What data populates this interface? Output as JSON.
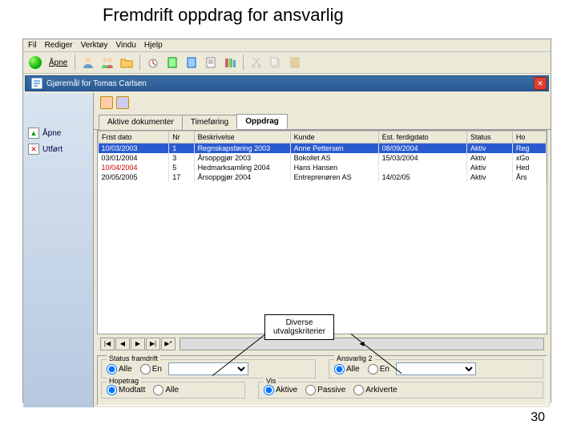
{
  "slide": {
    "title": "Fremdrift oppdrag for ansvarlig",
    "page": "30"
  },
  "menu": [
    "Fil",
    "Rediger",
    "Verktøy",
    "Vindu",
    "Hjelp"
  ],
  "toolbar": {
    "open_label": "Åpne"
  },
  "subwindow": {
    "title": "Gjøremål for Tomas Carlsen"
  },
  "sidebar": {
    "items": [
      {
        "icon": "↑",
        "label": "Åpne"
      },
      {
        "icon": "✕",
        "label": "Utført"
      }
    ]
  },
  "tabs": [
    "Aktive dokumenter",
    "Timeføring",
    "Oppdrag"
  ],
  "active_tab": 2,
  "grid": {
    "columns": [
      "Frist dato",
      "Nr",
      "Beskrivelse",
      "Kunde",
      "Est. ferdigdato",
      "Status",
      "Ho"
    ],
    "rows": [
      {
        "sel": true,
        "cells": [
          "10/03/2003",
          "1",
          "Regnskapsføring 2003",
          "Anne Pettersen",
          "08/09/2004",
          "Aktiv",
          "Reg"
        ]
      },
      {
        "cells": [
          "03/01/2004",
          "3",
          "Årsoppgjør 2003",
          "Bokollet AS",
          "15/03/2004",
          "Aktiv",
          "xGo"
        ]
      },
      {
        "red": true,
        "cells": [
          "10/04/2004",
          "5",
          "Hedmarksamling 2004",
          "Hans Hansen",
          "",
          "Aktiv",
          "Hed"
        ]
      },
      {
        "cells": [
          "20/05/2005",
          "17",
          "Årsoppgjør 2004",
          "Entreprenøren AS",
          "14/02/05",
          "Aktiv",
          "Års"
        ]
      }
    ]
  },
  "nav": [
    "|◀",
    "◀",
    "▶",
    "▶|",
    "▶*",
    "◀"
  ],
  "filters": {
    "status": {
      "label": "Status framdrift",
      "all": "Alle",
      "one": "En",
      "value": "Alle"
    },
    "ansvarlig2": {
      "label": "Ansvarlig 2",
      "all": "Alle",
      "one": "En",
      "value": "Alle"
    },
    "hopetrag": {
      "label": "Hopetrag",
      "modtatt": "Modtatt",
      "alle": "Alle",
      "value": "Modtatt"
    },
    "vis": {
      "label": "Vis",
      "aktive": "Aktive",
      "passive": "Passive",
      "arkiverte": "Arkiverte",
      "value": "Aktive"
    }
  },
  "callout": {
    "text1": "Diverse",
    "text2": "utvalgskriterier"
  }
}
